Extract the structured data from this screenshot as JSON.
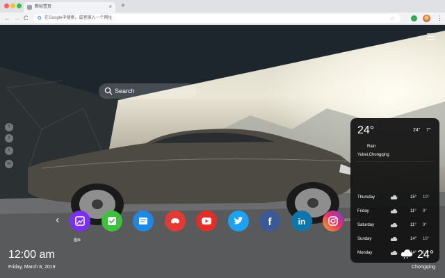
{
  "browser": {
    "tab_title": "新标签页",
    "tab_close": "×",
    "new_tab": "+",
    "omnibox_placeholder": "在Google中搜索，或者输入一个网址",
    "google_letter": "G"
  },
  "search": {
    "label": "Search"
  },
  "social_links": [
    {
      "icon": "facebook-icon",
      "glyph": "f"
    },
    {
      "icon": "twitter-icon",
      "glyph": "t"
    },
    {
      "icon": "tumblr-icon",
      "glyph": "t"
    },
    {
      "icon": "wechat-icon",
      "glyph": "w"
    }
  ],
  "shortcuts": [
    {
      "name": "gallery",
      "label": "图库",
      "color": "#7b2ff7",
      "icon": "gallery-icon"
    },
    {
      "name": "tasks",
      "label": "",
      "color": "#3ac23a",
      "icon": "check-icon"
    },
    {
      "name": "notes",
      "label": "",
      "color": "#1e88e5",
      "icon": "notes-icon"
    },
    {
      "name": "games",
      "label": "",
      "color": "#e53935",
      "icon": "gamepad-icon"
    },
    {
      "name": "youtube",
      "label": "",
      "color": "#e52d27",
      "icon": "youtube-icon"
    },
    {
      "name": "twitter",
      "label": "",
      "color": "#1da1f2",
      "icon": "twitter-bird-icon"
    },
    {
      "name": "facebook",
      "label": "",
      "color": "#3b5998",
      "icon": "facebook-icon"
    },
    {
      "name": "linkedin",
      "label": "",
      "color": "#0e76a8",
      "icon": "linkedin-icon"
    },
    {
      "name": "instagram",
      "label": "",
      "color": "#e1306c",
      "icon": "instagram-icon"
    }
  ],
  "amazon_label": "amazon",
  "weather": {
    "temp": "24°",
    "high": "24°",
    "low": "7°",
    "condition": "Rain",
    "location": "Yubei,Chongqing",
    "forecast": [
      {
        "day": "Thursday",
        "high": "15°",
        "low": "10°",
        "icon": "cloud-icon"
      },
      {
        "day": "Friday",
        "high": "11°",
        "low": "8°",
        "icon": "cloud-icon"
      },
      {
        "day": "Saturday",
        "high": "11°",
        "low": "9°",
        "icon": "cloud-icon"
      },
      {
        "day": "Sunday",
        "high": "14°",
        "low": "10°",
        "icon": "cloud-icon"
      },
      {
        "day": "Monday",
        "high": "14°",
        "low": "10°",
        "icon": "cloud-icon"
      }
    ]
  },
  "clock": {
    "time": "12:00 am",
    "date": "Friday, March 8, 2019"
  },
  "bottom_weather": {
    "temp": "24°",
    "city": "Chongqing"
  }
}
